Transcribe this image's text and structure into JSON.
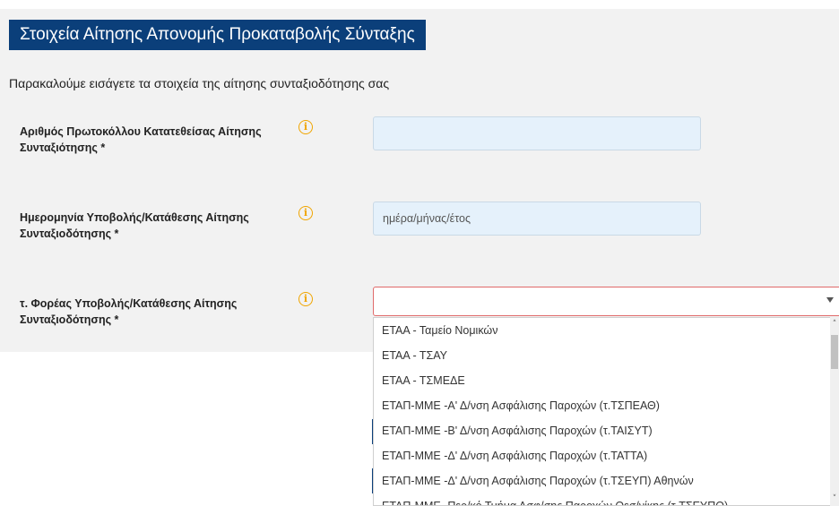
{
  "form": {
    "title": "Στοιχεία Αίτησης Απονομής Προκαταβολής Σύνταξης",
    "intro": "Παρακαλούμε εισάγετε τα στοιχεία της αίτησης συνταξιοδότησης σας",
    "fields": [
      {
        "label_line1": "Αριθμός Πρωτοκόλλου Κατατεθείσας Αίτησης",
        "label_line2": "Συνταξιότησης *",
        "value": "",
        "placeholder": ""
      },
      {
        "label_line1": "Ημερομηνία Υποβολής/Κατάθεσης Αίτησης",
        "label_line2": "Συνταξιοδότησης *",
        "value": "",
        "placeholder": "ημέρα/μήνας/έτος"
      },
      {
        "label_line1": "τ. Φορέας Υποβολής/Κατάθεσης Αίτησης",
        "label_line2": "Συνταξιοδότησης *",
        "selected": ""
      }
    ],
    "info_icon": "info-icon",
    "dropdown_options": [
      "ΕΤΑΑ - Ταμείο Νομικών",
      "ΕΤΑΑ - ΤΣΑΥ",
      "ΕΤΑΑ - ΤΣΜΕΔΕ",
      "ΕΤΑΠ-ΜΜΕ -Α' Δ/νση Ασφάλισης Παροχών (τ.ΤΣΠΕΑΘ)",
      "ΕΤΑΠ-ΜΜΕ -Β' Δ/νση Ασφάλισης Παροχών (τ.ΤΑΙΣΥΤ)",
      "ΕΤΑΠ-ΜΜΕ -Δ' Δ/νση Ασφάλισης Παροχών (τ.ΤΑΤΤΑ)",
      "ΕΤΑΠ-ΜΜΕ -Δ' Δ/νση Ασφάλισης Παροχών (τ.ΤΣΕΥΠ) Αθηνών",
      "ΕΤΑΠ-ΜΜΕ -Περ/κό Τμήμα Ασφ/σης Παροχών Θεσ/νίκης (τ.ΤΣΕΥΠΘ)"
    ]
  },
  "colors": {
    "title_bg": "#0b3f7a",
    "panel_bg": "#f2f2f2",
    "field_bg": "#e5f1fb",
    "info_icon": "#f0a500",
    "error_border": "#e06a6a"
  }
}
